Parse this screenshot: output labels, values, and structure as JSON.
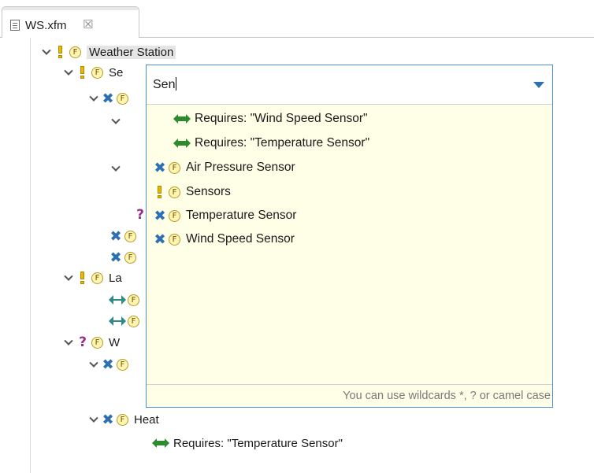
{
  "tab": {
    "file_icon": "feature-model-file-icon",
    "title": "WS.xfm",
    "close": "☒"
  },
  "tree": {
    "root": "Weather Station",
    "sensors_partial": "Se",
    "la_partial": "La",
    "w_partial": "W",
    "heat": "Heat",
    "heat_requires": "Requires: \"Temperature Sensor\""
  },
  "popup": {
    "query": "Sen",
    "items": [
      {
        "icon": "requires-arrow-icon",
        "label": "Requires: \"Wind Speed Sensor\""
      },
      {
        "icon": "requires-arrow-icon",
        "label": "Requires: \"Temperature Sensor\""
      },
      {
        "icon": "optional-x-icon",
        "label": "Air Pressure Sensor"
      },
      {
        "icon": "mandatory-exclamation-icon",
        "label": "Sensors"
      },
      {
        "icon": "optional-x-icon",
        "label": "Temperature Sensor"
      },
      {
        "icon": "optional-x-icon",
        "label": "Wind Speed Sensor"
      }
    ],
    "footer_hint": "You can use wildcards *, ? or camel case"
  },
  "colors": {
    "popup_bg": "#fffee6",
    "popup_border": "#4a8fd6",
    "requires_arrow": "#2f8a2f",
    "optional_x": "#2c6fb3",
    "alternative_q": "#9a2c8c",
    "feature_badge": "#fff4b0"
  }
}
